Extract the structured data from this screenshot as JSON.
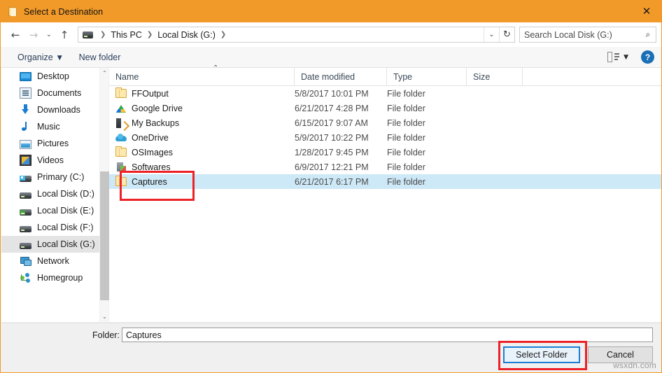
{
  "window": {
    "title": "Select a Destination",
    "title_icon": "folder-icon",
    "close_label": "✕",
    "accent_color": "#f29a29"
  },
  "addressbar": {
    "back_icon": "←",
    "forward_icon": "→",
    "recent_icon": "⌄",
    "up_icon": "↑",
    "pc_icon": "this-pc-icon",
    "crumbs": [
      "This PC",
      "Local Disk (G:)"
    ],
    "separator": "❯",
    "dropdown_icon": "⌄",
    "refresh_icon": "↻",
    "search_placeholder": "Search Local Disk (G:)",
    "search_value": "",
    "search_icon": "⌕"
  },
  "commandbar": {
    "organize_label": "Organize",
    "organize_caret": "▼",
    "new_folder_label": "New folder",
    "view_caret": "▼",
    "help_label": "?"
  },
  "sidebar": {
    "items": [
      {
        "label": "Desktop",
        "icon": "desktop-icon",
        "selected": false
      },
      {
        "label": "Documents",
        "icon": "documents-icon",
        "selected": false
      },
      {
        "label": "Downloads",
        "icon": "downloads-icon",
        "selected": false
      },
      {
        "label": "Music",
        "icon": "music-icon",
        "selected": false
      },
      {
        "label": "Pictures",
        "icon": "pictures-icon",
        "selected": false
      },
      {
        "label": "Videos",
        "icon": "videos-icon",
        "selected": false
      },
      {
        "label": "Primary (C:)",
        "icon": "drive-icon",
        "selected": false
      },
      {
        "label": "Local Disk (D:)",
        "icon": "drive-icon",
        "selected": false
      },
      {
        "label": "Local Disk (E:)",
        "icon": "drive-icon",
        "selected": false
      },
      {
        "label": "Local Disk (F:)",
        "icon": "drive-icon",
        "selected": false
      },
      {
        "label": "Local Disk (G:)",
        "icon": "drive-icon",
        "selected": true
      },
      {
        "label": "Network",
        "icon": "network-icon",
        "selected": false
      },
      {
        "label": "Homegroup",
        "icon": "homegroup-icon",
        "selected": false
      }
    ],
    "scroll_up_icon": "⌃",
    "scroll_down_icon": "⌄"
  },
  "filelist": {
    "columns": [
      "Name",
      "Date modified",
      "Type",
      "Size"
    ],
    "sort_indicator": "⌃",
    "rows": [
      {
        "name": "FFOutput",
        "icon": "folder-icon",
        "date": "5/8/2017 10:01 PM",
        "type": "File folder",
        "size": "",
        "selected": false
      },
      {
        "name": "Google Drive",
        "icon": "google-drive-icon",
        "date": "6/21/2017 4:28 PM",
        "type": "File folder",
        "size": "",
        "selected": false
      },
      {
        "name": "My Backups",
        "icon": "backup-icon",
        "date": "6/15/2017 9:07 AM",
        "type": "File folder",
        "size": "",
        "selected": false
      },
      {
        "name": "OneDrive",
        "icon": "onedrive-icon",
        "date": "5/9/2017 10:22 PM",
        "type": "File folder",
        "size": "",
        "selected": false
      },
      {
        "name": "OSImages",
        "icon": "folder-icon",
        "date": "1/28/2017 9:45 PM",
        "type": "File folder",
        "size": "",
        "selected": false
      },
      {
        "name": "Softwares",
        "icon": "softwares-icon",
        "date": "6/9/2017 12:21 PM",
        "type": "File folder",
        "size": "",
        "selected": false
      },
      {
        "name": "Captures",
        "icon": "folder-icon",
        "date": "6/21/2017 6:17 PM",
        "type": "File folder",
        "size": "",
        "selected": true
      }
    ]
  },
  "bottom": {
    "folder_label": "Folder:",
    "folder_value": "Captures",
    "folder_placeholder": "",
    "select_folder_label": "Select Folder",
    "cancel_label": "Cancel"
  },
  "annotations": {
    "highlight_color": "#ec2227",
    "watermark": "wsxdn.com"
  }
}
